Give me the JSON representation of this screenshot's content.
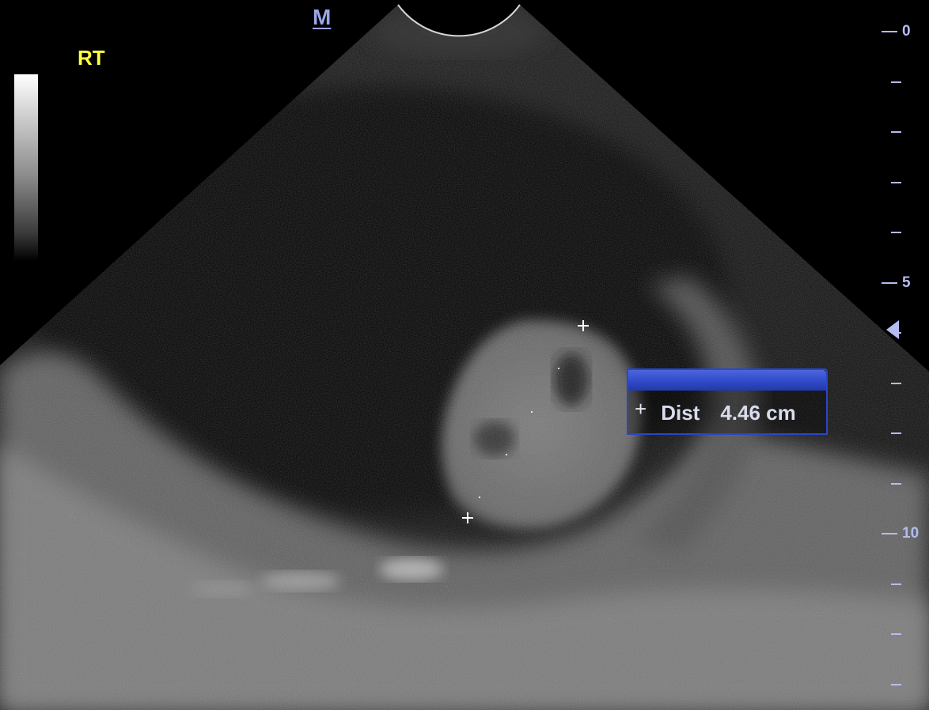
{
  "image": {
    "orientation_label": "RT",
    "probe_marker": "M",
    "depth_scale": {
      "unit_labels": [
        "0",
        "5",
        "10"
      ],
      "ticks": [
        0,
        1,
        2,
        3,
        4,
        5,
        6,
        7,
        8,
        9,
        10,
        11,
        12,
        13
      ],
      "focus_depth": 6
    },
    "measurement": {
      "icon": "crosshair-icon",
      "label": "Dist",
      "value": "4.46 cm"
    },
    "colors": {
      "orientation_label": "#ffff40",
      "scale": "#b4bcf0",
      "measurement_header": "#2e48c6"
    }
  }
}
